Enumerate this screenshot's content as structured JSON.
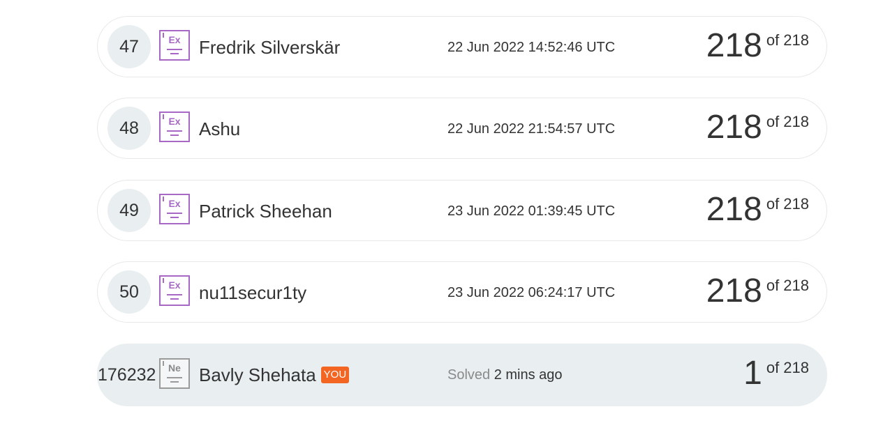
{
  "leaderboard": {
    "rows": [
      {
        "rank": "47",
        "badge_symbol": "Ex",
        "badge_icon": "excellent-badge-icon",
        "name": "Fredrik Silverskär",
        "time": "22 Jun 2022 14:52:46 UTC",
        "score": "218",
        "total": "of 218"
      },
      {
        "rank": "48",
        "badge_symbol": "Ex",
        "badge_icon": "excellent-badge-icon",
        "name": "Ashu",
        "time": "22 Jun 2022 21:54:57 UTC",
        "score": "218",
        "total": "of 218"
      },
      {
        "rank": "49",
        "badge_symbol": "Ex",
        "badge_icon": "excellent-badge-icon",
        "name": "Patrick Sheehan",
        "time": "23 Jun 2022 01:39:45 UTC",
        "score": "218",
        "total": "of 218"
      },
      {
        "rank": "50",
        "badge_symbol": "Ex",
        "badge_icon": "excellent-badge-icon",
        "name": "nu11secur1ty",
        "time": "23 Jun 2022 06:24:17 UTC",
        "score": "218",
        "total": "of 218"
      }
    ],
    "current_user": {
      "rank": "176232",
      "badge_symbol": "Ne",
      "badge_icon": "newbie-badge-icon",
      "name": "Bavly Shehata",
      "you_label": "YOU",
      "solved_label": "Solved",
      "solved_time": "2 mins ago",
      "score": "1",
      "total": "of 218"
    }
  },
  "colors": {
    "badge_purple": "#a668c4",
    "badge_grey": "#9a9a9a",
    "rank_bg": "#e9eef0",
    "you_tag": "#f26522",
    "text": "#333333",
    "muted": "#8a8a8a"
  }
}
